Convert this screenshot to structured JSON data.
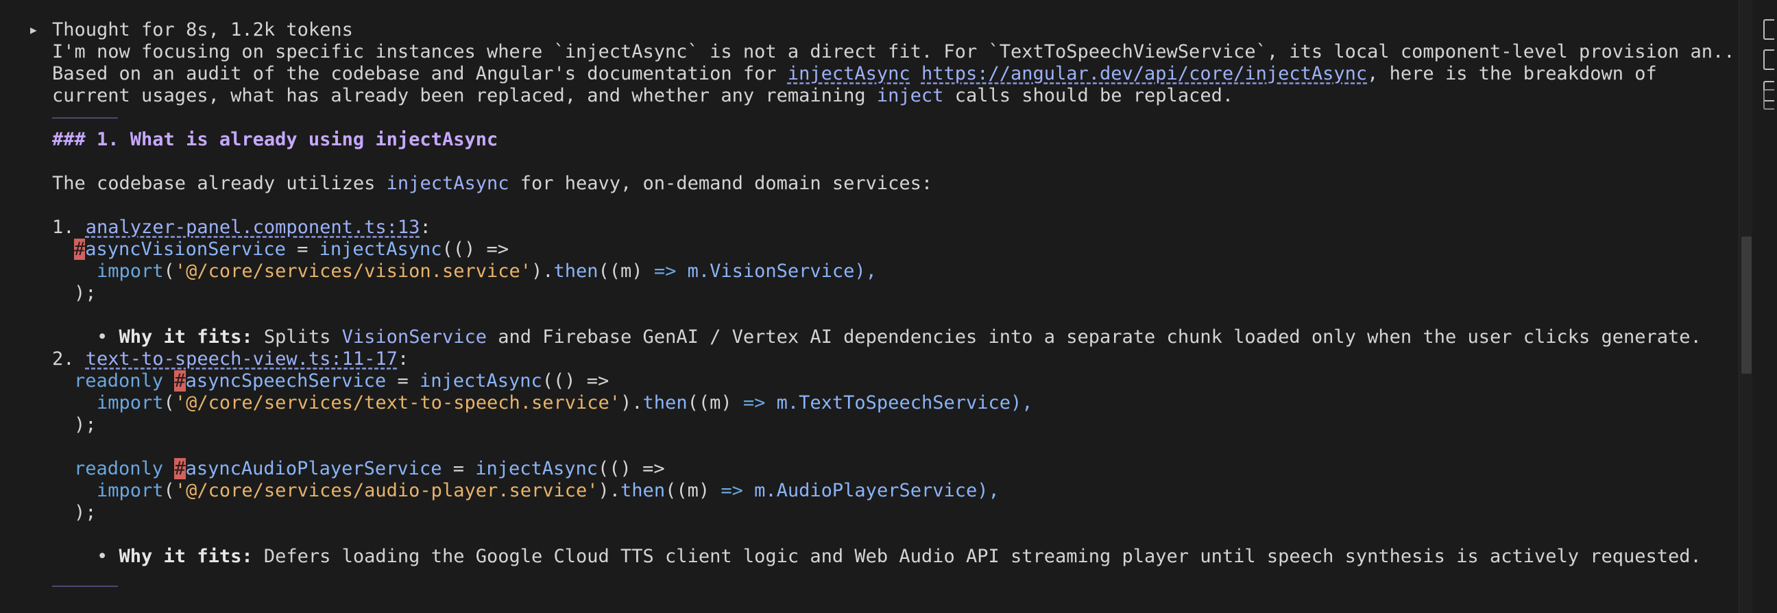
{
  "thought": {
    "summary": "Thought for 8s, 1.2k tokens",
    "text": "I'm now focusing on specific instances where `injectAsync` is not a direct fit. For `TextToSpeechViewService`, its local component-level provision an..."
  },
  "intro": {
    "prefix": "Based on an audit of the codebase and Angular's documentation for ",
    "link1": "injectAsync",
    "link2": "https://angular.dev/api/core/injectAsync",
    "suffix": ", here is the breakdown of",
    "line2_prefix": "current usages, what has already been replaced, and whether any remaining ",
    "line2_code": "inject",
    "line2_suffix": " calls should be replaced."
  },
  "section1": {
    "heading_prefix": "### 1. What is already using ",
    "heading_code": "injectAsync",
    "sentence_prefix": "The codebase already utilizes ",
    "sentence_code": "injectAsync",
    "sentence_suffix": " for heavy, on-demand domain services:"
  },
  "item1": {
    "num": "1. ",
    "link": "analyzer-panel.component.ts:13",
    "colon": ":",
    "code": {
      "hash": "#",
      "name": "asyncVisionService",
      "assign": " = ",
      "fn": "injectAsync",
      "open": "(() =>",
      "import": "import",
      "paren": "(",
      "path": "'@/core/services/vision.service'",
      "then_dot": ").",
      "then": "then",
      "args": "((m) ",
      "arrow": "=>",
      "tail": " m.VisionService),",
      "close": ");"
    },
    "bullet": "•",
    "why_label": "Why it fits:",
    "why_pre": " Splits ",
    "why_code": "VisionService",
    "why_post": " and Firebase GenAI / Vertex AI dependencies into a separate chunk loaded only when the user clicks generate."
  },
  "item2": {
    "num": "2. ",
    "link": "text-to-speech-view.ts:11-17",
    "colon": ":",
    "code_a": {
      "kw": "readonly",
      "hash": "#",
      "name": "asyncSpeechService",
      "assign": " = ",
      "fn": "injectAsync",
      "open": "(() =>",
      "import": "import",
      "path": "'@/core/services/text-to-speech.service'",
      "then": "then",
      "args": "((m) ",
      "arrow": "=>",
      "tail": " m.TextToSpeechService),",
      "close": ");"
    },
    "code_b": {
      "kw": "readonly",
      "hash": "#",
      "name": "asyncAudioPlayerService",
      "assign": " = ",
      "fn": "injectAsync",
      "open": "(() =>",
      "import": "import",
      "path": "'@/core/services/audio-player.service'",
      "then": "then",
      "args": "((m) ",
      "arrow": "=>",
      "tail": " m.AudioPlayerService),",
      "close": ");"
    },
    "bullet": "•",
    "why_label": "Why it fits:",
    "why_text": " Defers loading the Google Cloud TTS client logic and Web Audio API streaming player until speech synthesis is actively requested."
  }
}
